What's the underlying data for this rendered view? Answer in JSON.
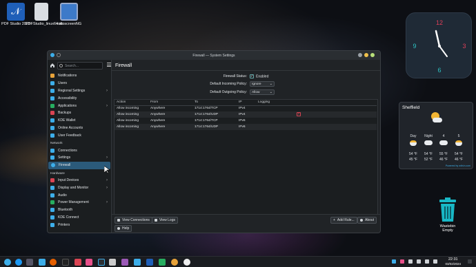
{
  "desktop": {
    "icons": [
      {
        "label": "PDF Studio 2023",
        "icon": "pdf-studio-icon",
        "color": "#1f5fb8"
      },
      {
        "label": "PDFStudio_linux64.sh",
        "icon": "script-file-icon",
        "color": "#d9dde2"
      },
      {
        "label": "vokoscreenNG",
        "icon": "vokoscreen-icon",
        "color": "#3d7ac9"
      }
    ],
    "trash": {
      "label": "Wastebin",
      "sub": "Empty",
      "icon": "wastebin-icon"
    }
  },
  "clock_widget": {
    "numerals": [
      "12",
      "3",
      "6",
      "9"
    ],
    "accent": "#e0405a",
    "secondary": "#2ec4c4"
  },
  "weather_widget": {
    "city": "Sheffield",
    "days": [
      "Day",
      "Night",
      "4",
      "5"
    ],
    "highs": [
      "54 °F",
      "54 °F",
      "55 °F",
      "54 °F"
    ],
    "lows": [
      "45 °F",
      "52 °F",
      "46 °F",
      "46 °F"
    ],
    "credit": "Powered by wttr.in.com"
  },
  "window": {
    "title": "Firewall — System Settings",
    "search_placeholder": "Search...",
    "nav": [
      {
        "label": "Notifications",
        "icon": "bell-icon",
        "color": "#e8a33a"
      },
      {
        "label": "Users",
        "icon": "user-icon",
        "color": "#3daee9"
      },
      {
        "label": "Regional Settings",
        "icon": "globe-icon",
        "color": "#3daee9",
        "chevron": true
      },
      {
        "label": "Accessibility",
        "icon": "accessibility-icon",
        "color": "#3daee9"
      },
      {
        "label": "Applications",
        "icon": "applications-icon",
        "color": "#27ae60",
        "chevron": true
      },
      {
        "label": "Backups",
        "icon": "backup-icon",
        "color": "#da4453"
      },
      {
        "label": "KDE Wallet",
        "icon": "wallet-icon",
        "color": "#3daee9"
      },
      {
        "label": "Online Accounts",
        "icon": "accounts-icon",
        "color": "#3daee9"
      },
      {
        "label": "User Feedback",
        "icon": "feedback-icon",
        "color": "#3daee9"
      }
    ],
    "network_header": "Network",
    "network_nav": [
      {
        "label": "Connections",
        "icon": "connections-icon",
        "color": "#3daee9"
      },
      {
        "label": "Settings",
        "icon": "network-settings-icon",
        "color": "#3daee9",
        "chevron": true
      },
      {
        "label": "Firewall",
        "icon": "firewall-icon",
        "color": "#3daee9",
        "active": true
      }
    ],
    "hardware_header": "Hardware",
    "hardware_nav": [
      {
        "label": "Input Devices",
        "icon": "input-devices-icon",
        "color": "#da4453",
        "chevron": true
      },
      {
        "label": "Display and Monitor",
        "icon": "display-icon",
        "color": "#3daee9",
        "chevron": true
      },
      {
        "label": "Audio",
        "icon": "audio-icon",
        "color": "#3daee9"
      },
      {
        "label": "Power Management",
        "icon": "power-icon",
        "color": "#27ae60",
        "chevron": true
      },
      {
        "label": "Bluetooth",
        "icon": "bluetooth-icon",
        "color": "#3daee9"
      },
      {
        "label": "KDE Connect",
        "icon": "kde-connect-icon",
        "color": "#3daee9"
      },
      {
        "label": "Printers",
        "icon": "printer-icon",
        "color": "#3daee9"
      }
    ],
    "page_title": "Firewall",
    "firewall_status_label": "Firewall Status:",
    "firewall_status_value": "Enabled",
    "incoming_label": "Default Incoming Policy:",
    "incoming_value": "Ignore",
    "outgoing_label": "Default Outgoing Policy:",
    "outgoing_value": "Allow",
    "columns": [
      "Action",
      "From",
      "To",
      "IP",
      "Logging"
    ],
    "rows": [
      [
        "Allow incoming",
        "Anywhere",
        "1714:1764/TCP",
        "IPv4",
        ""
      ],
      [
        "Allow incoming",
        "Anywhere",
        "1714:1764/UDP",
        "IPv4",
        ""
      ],
      [
        "Allow incoming",
        "Anywhere",
        "1714:1764/TCP",
        "IPv6",
        ""
      ],
      [
        "Allow incoming",
        "Anywhere",
        "1714:1764/UDP",
        "IPv6",
        ""
      ]
    ],
    "view_connections": "View Connections",
    "view_logs": "View Logs",
    "add_rule": "Add Rule...",
    "about": "About",
    "help": "Help"
  },
  "taskbar": {
    "time": "22:31",
    "date": "03/02/2024"
  }
}
